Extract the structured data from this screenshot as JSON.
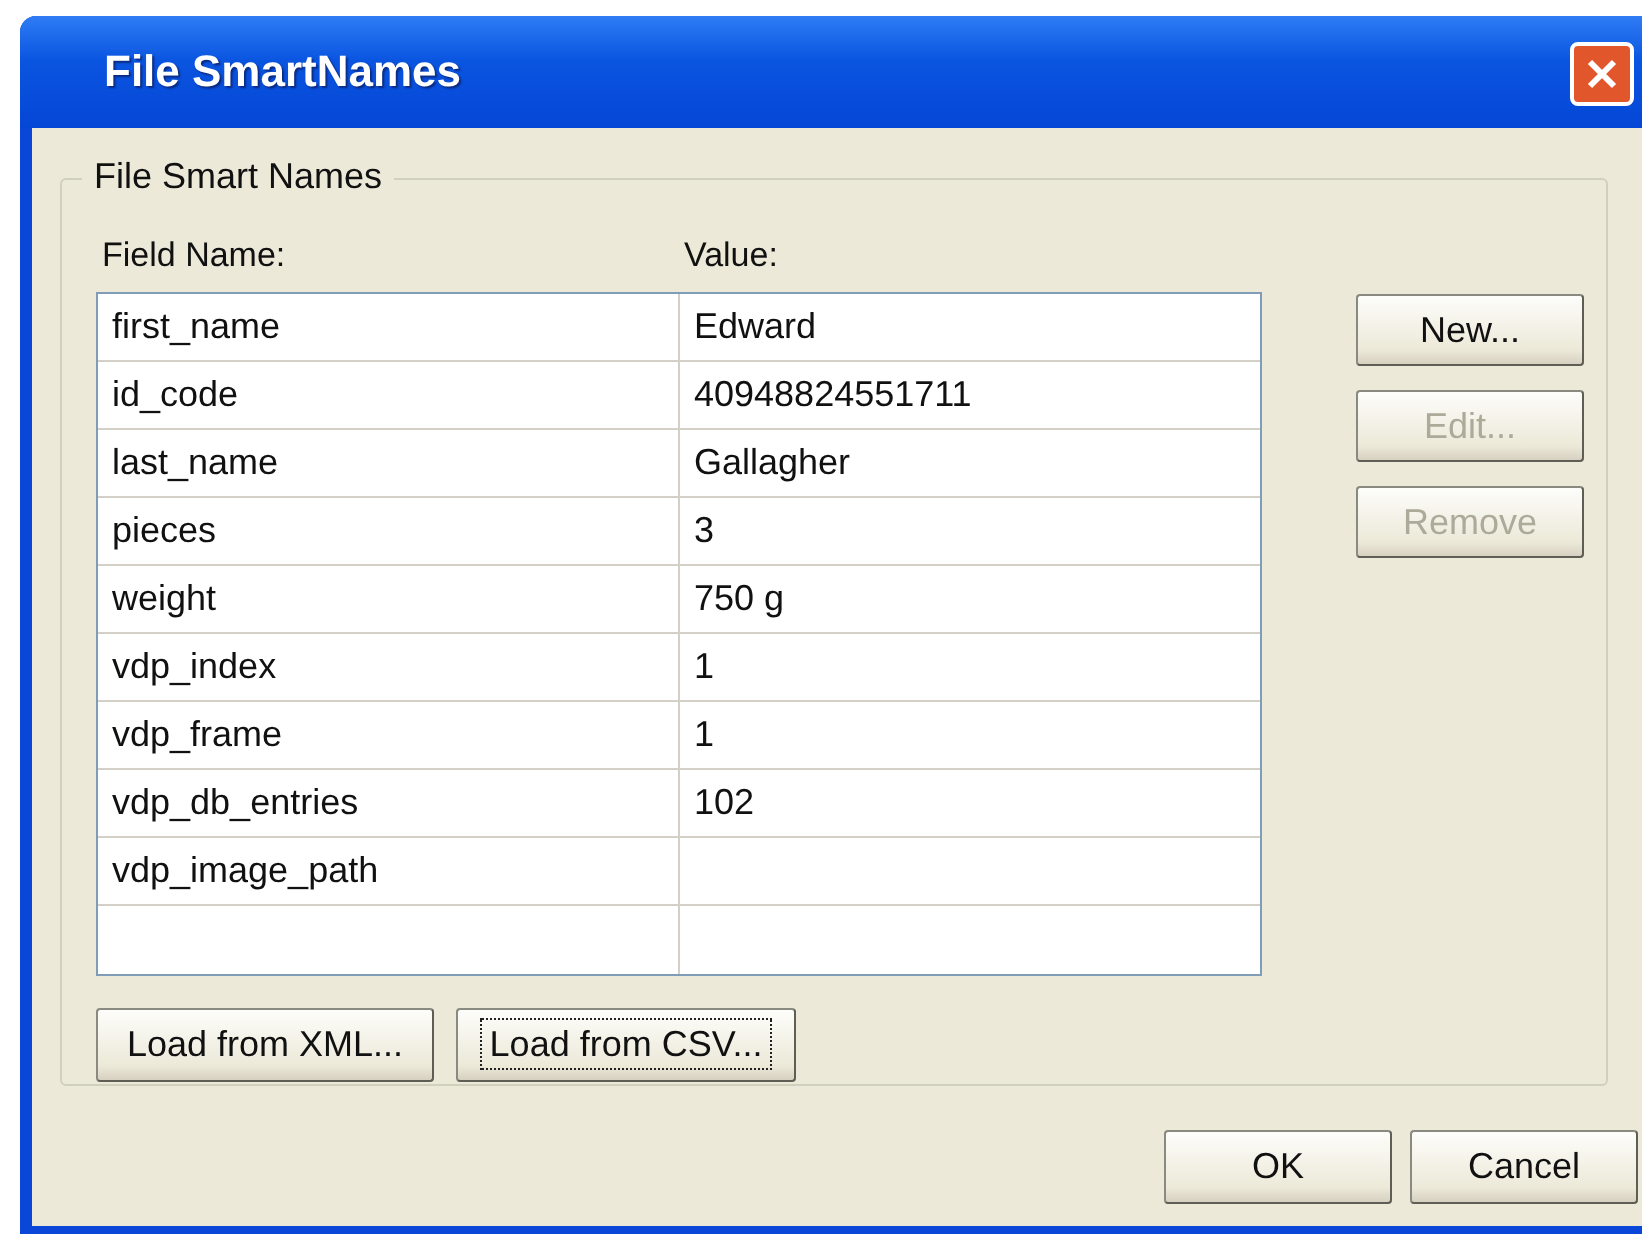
{
  "window": {
    "title": "File SmartNames"
  },
  "group": {
    "title": "File Smart Names"
  },
  "table": {
    "columns": [
      "Field Name:",
      "Value:"
    ],
    "rows": [
      {
        "name": "first_name",
        "value": "Edward"
      },
      {
        "name": "id_code",
        "value": "40948824551711"
      },
      {
        "name": "last_name",
        "value": "Gallagher"
      },
      {
        "name": "pieces",
        "value": "3"
      },
      {
        "name": "weight",
        "value": "750 g"
      },
      {
        "name": "vdp_index",
        "value": "1"
      },
      {
        "name": "vdp_frame",
        "value": "1"
      },
      {
        "name": "vdp_db_entries",
        "value": "102"
      },
      {
        "name": "vdp_image_path"
      }
    ]
  },
  "side_buttons": [
    {
      "label": "New...",
      "disabled": false
    },
    {
      "label": "Edit...",
      "disabled": true
    },
    {
      "label": "Remove",
      "disabled": true
    }
  ],
  "load_buttons": [
    {
      "label": "Load from XML...",
      "focused": false
    },
    {
      "label": "Load from CSV...",
      "focused": true
    }
  ],
  "dialog_buttons": [
    {
      "label": "OK"
    },
    {
      "label": "Cancel"
    }
  ]
}
